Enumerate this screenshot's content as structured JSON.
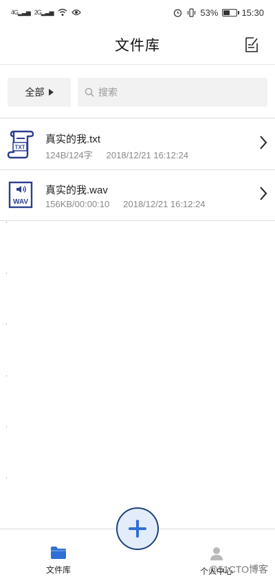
{
  "status_bar": {
    "signal_1": "4G",
    "signal_2": "2G",
    "battery_percent_text": "53%",
    "battery_level": 0.53,
    "time": "15:30"
  },
  "header": {
    "title": "文件库",
    "edit_icon": "edit-note-icon"
  },
  "filter": {
    "dropdown_label": "全部",
    "search_placeholder": "搜索"
  },
  "files": [
    {
      "name": "真实的我.txt",
      "size": "124B/124字",
      "date": "2018/12/21 16:12:24",
      "icon": "txt-scroll-icon",
      "badge": "TXT"
    },
    {
      "name": "真实的我.wav",
      "size": "156KB/00:00:10",
      "date": "2018/12/21 16:12:24",
      "icon": "wav-audio-icon",
      "badge": "WAV"
    }
  ],
  "bottom_nav": {
    "library_label": "文件库",
    "profile_label": "个人中心",
    "add_icon": "plus-icon"
  },
  "watermark": "@51CTO博客",
  "colors": {
    "accent": "#2f6fd6",
    "add_button_bg": "#e3ecfb",
    "add_button_border": "#1c3f7a",
    "icon_navy": "#2b3d8f"
  }
}
